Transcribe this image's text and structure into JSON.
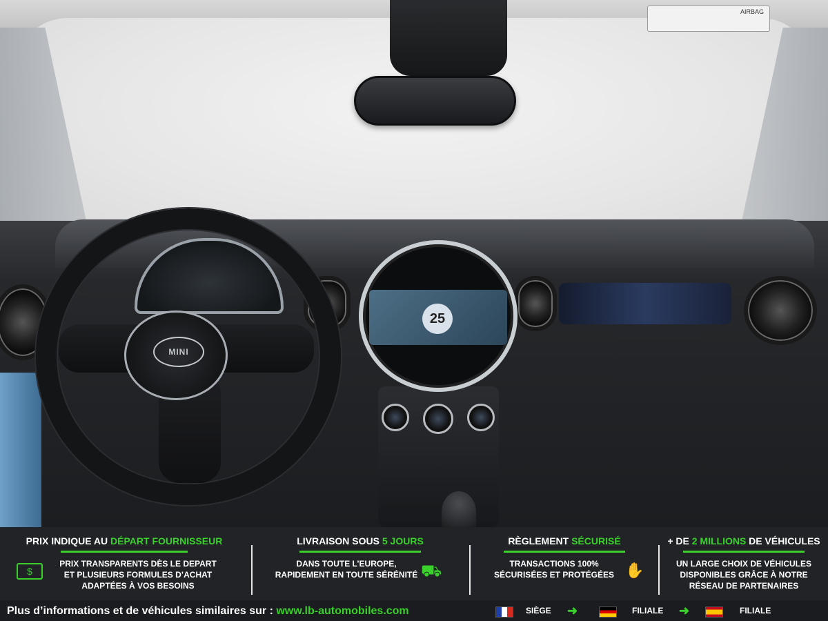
{
  "photo": {
    "airbag_label": "AIRBAG",
    "steering_logo": "MINI",
    "screen_day": "25"
  },
  "info_bar": {
    "columns": [
      {
        "title_prefix": "PRIX INDIQUE AU ",
        "title_highlight": "DÉPART FOURNISSEUR",
        "title_suffix": "",
        "body_lines": [
          "PRIX TRANSPARENTS DÈS LE DEPART",
          "ET PLUSIEURS FORMULES D’ACHAT",
          "ADAPTÉES À VOS BESOINS"
        ],
        "icon": "money-icon"
      },
      {
        "title_prefix": "LIVRAISON SOUS ",
        "title_highlight": "5 JOURS",
        "title_suffix": "",
        "body_lines": [
          "DANS TOUTE L’EUROPE,",
          "RAPIDEMENT EN TOUTE SÉRÉNITÉ"
        ],
        "icon": "truck-icon"
      },
      {
        "title_prefix": "RÈGLEMENT ",
        "title_highlight": "SÉCURISÉ",
        "title_suffix": "",
        "body_lines": [
          "TRANSACTIONS 100%",
          "SÉCURISÉES ET PROTÉGÉES"
        ],
        "icon": "handshake-icon"
      },
      {
        "title_prefix": "+ DE ",
        "title_highlight": "2 MILLIONS",
        "title_suffix": " DE VÉHICULES",
        "body_lines": [
          "UN LARGE CHOIX DE VÉHICULES",
          "DISPONIBLES GRÂCE À NOTRE",
          "RÉSEAU DE PARTENAIRES"
        ],
        "icon": ""
      }
    ],
    "accent_color": "#39d12a"
  },
  "footer": {
    "text": "Plus d’informations et de véhicules similaires sur : ",
    "link": "www.lb-automobiles.com",
    "locations": [
      {
        "flag": "flag-france-icon",
        "label": "SIÈGE"
      },
      {
        "flag": "flag-germany-icon",
        "label": "FILIALE"
      },
      {
        "flag": "flag-spain-icon",
        "label": "FILIALE"
      }
    ]
  }
}
